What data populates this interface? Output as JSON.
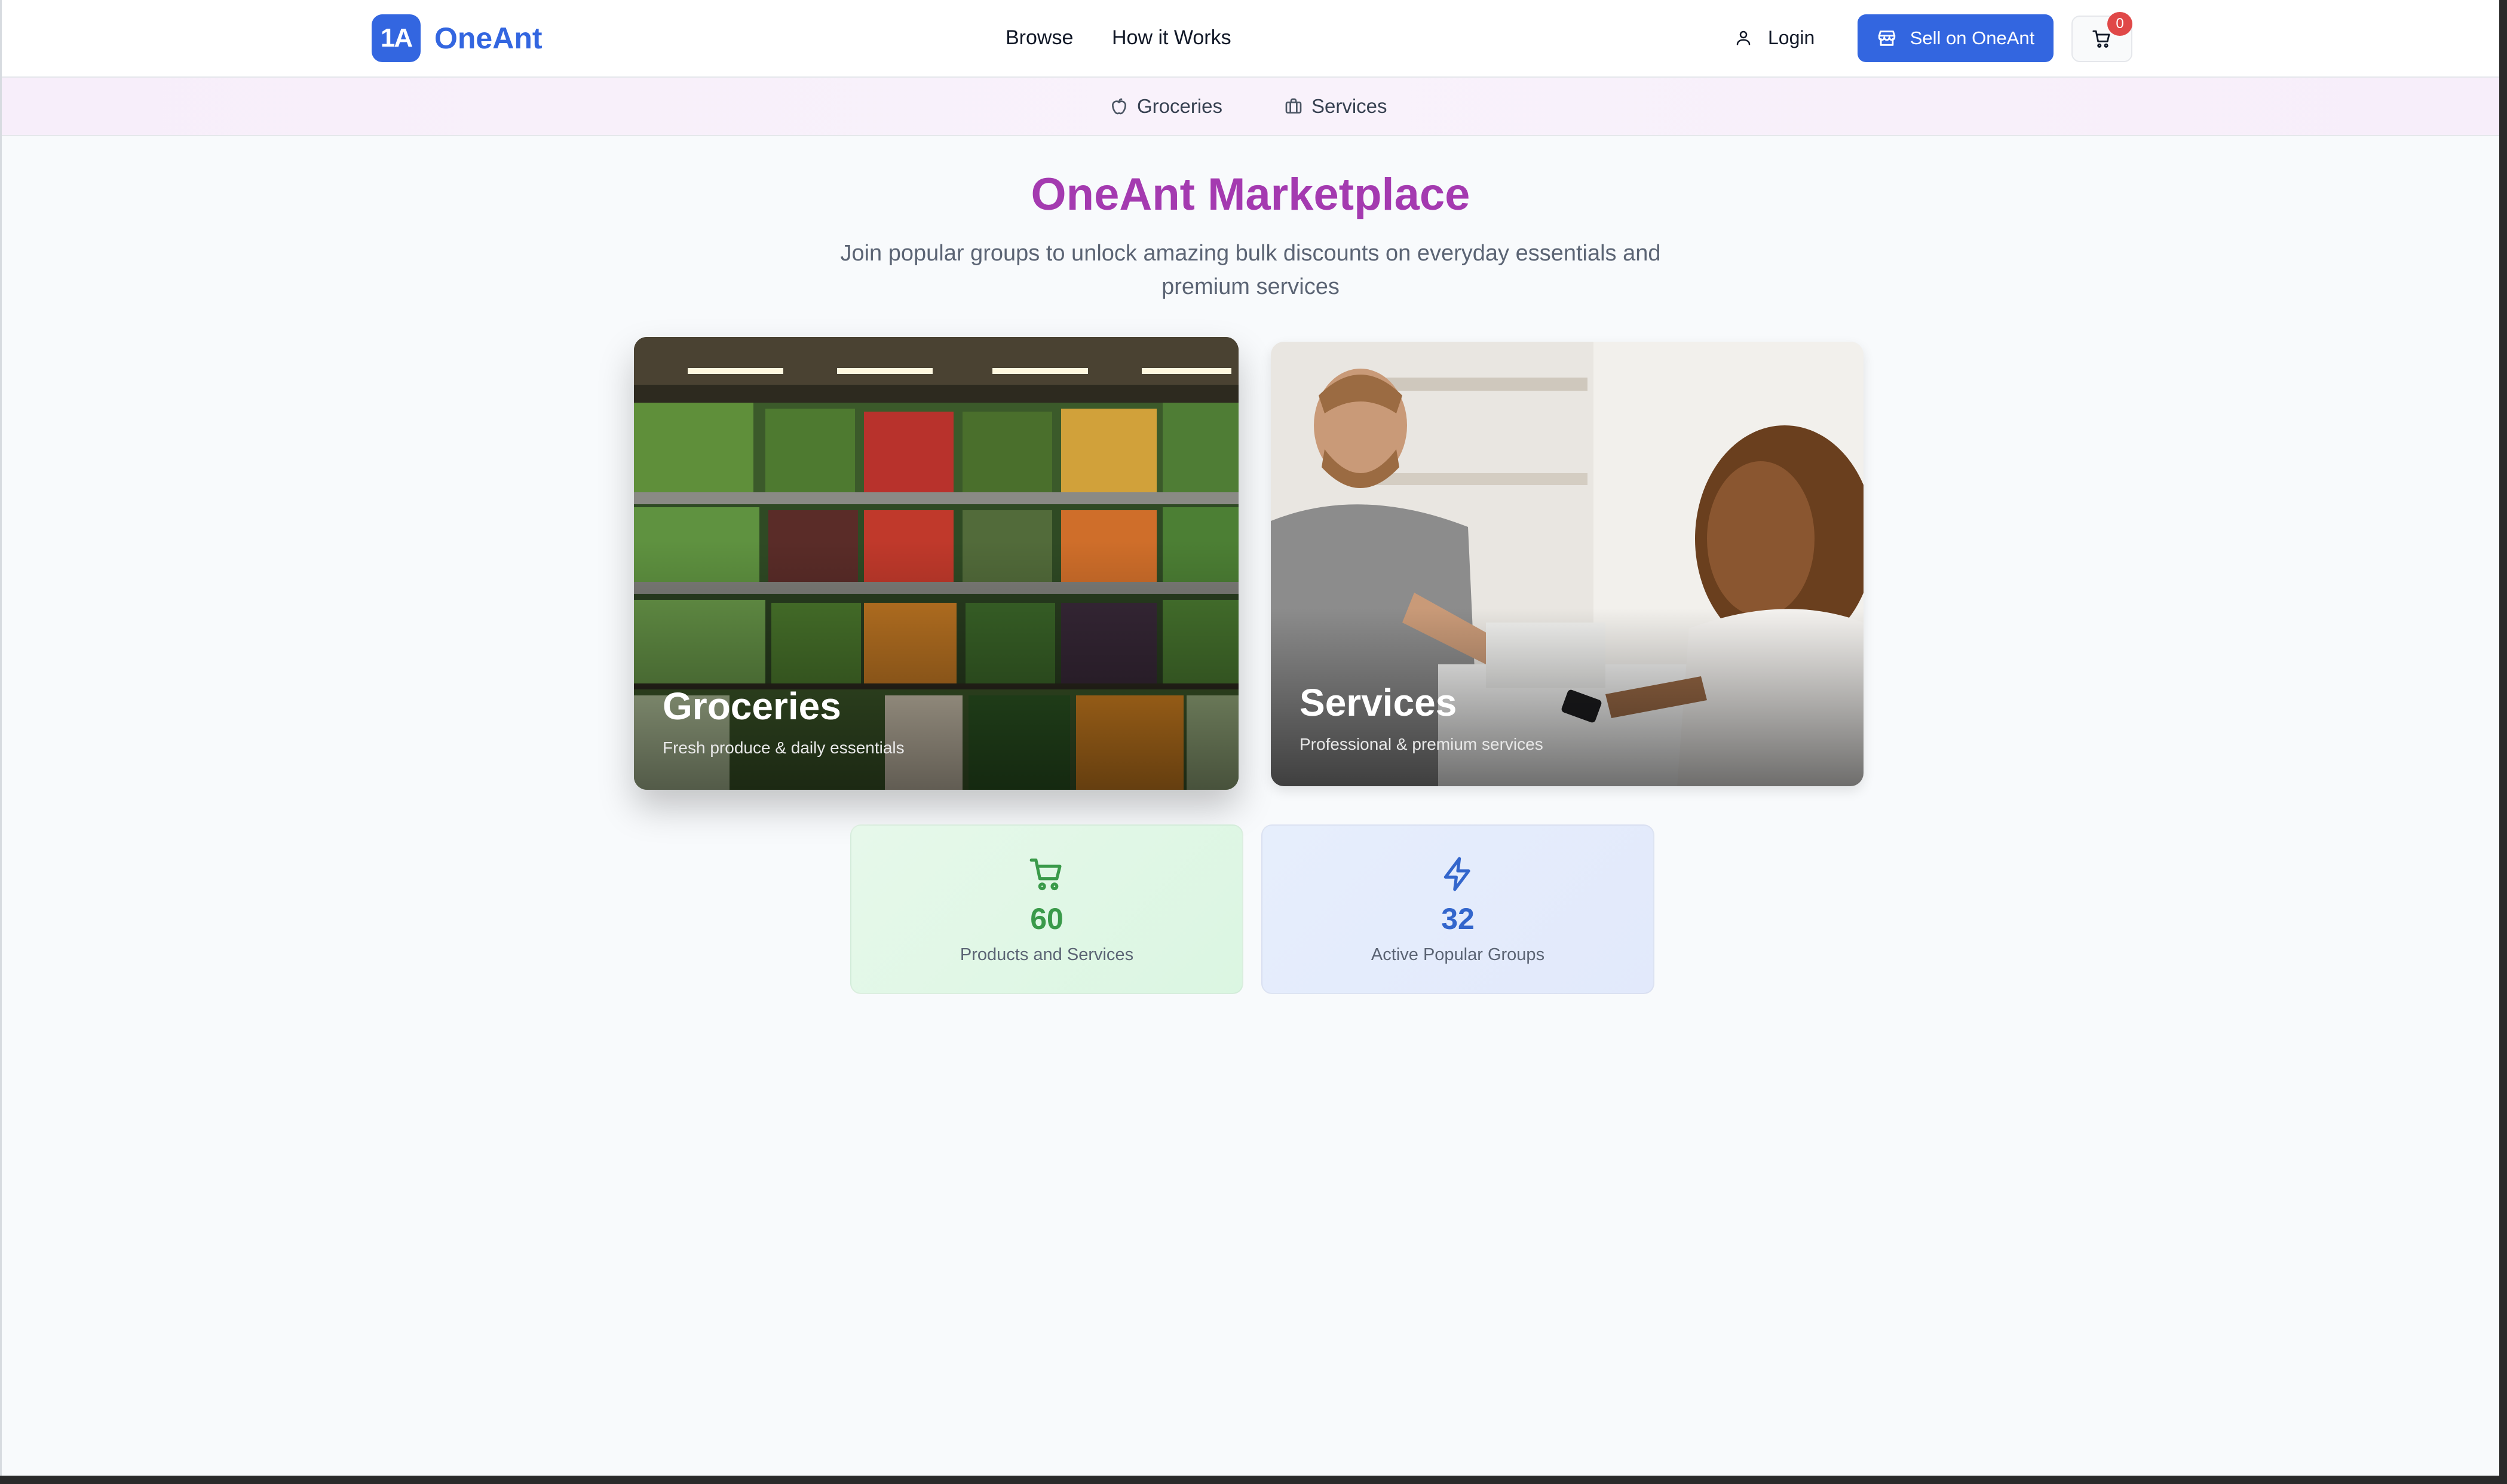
{
  "brand": {
    "badge": "1A",
    "name": "OneAnt"
  },
  "nav": {
    "browse": "Browse",
    "how_it_works": "How it Works"
  },
  "actions": {
    "login": "Login",
    "sell": "Sell on OneAnt",
    "cart_count": "0"
  },
  "categories": [
    {
      "label": "Groceries",
      "icon": "apple-icon"
    },
    {
      "label": "Services",
      "icon": "briefcase-icon"
    }
  ],
  "hero": {
    "title": "OneAnt Marketplace",
    "subtitle": "Join popular groups to unlock amazing bulk discounts on everyday essentials and premium services"
  },
  "cards": [
    {
      "title": "Groceries",
      "subtitle": "Fresh produce & daily essentials"
    },
    {
      "title": "Services",
      "subtitle": "Professional & premium services"
    }
  ],
  "stats": [
    {
      "value": "60",
      "label": "Products and Services",
      "icon": "cart-icon",
      "color": "#3a9a4a"
    },
    {
      "value": "32",
      "label": "Active Popular Groups",
      "icon": "lightning-icon",
      "color": "#3366cc"
    }
  ],
  "colors": {
    "accent": "#3366e0",
    "hero_title": "#a43ab0",
    "badge": "#e04848"
  }
}
